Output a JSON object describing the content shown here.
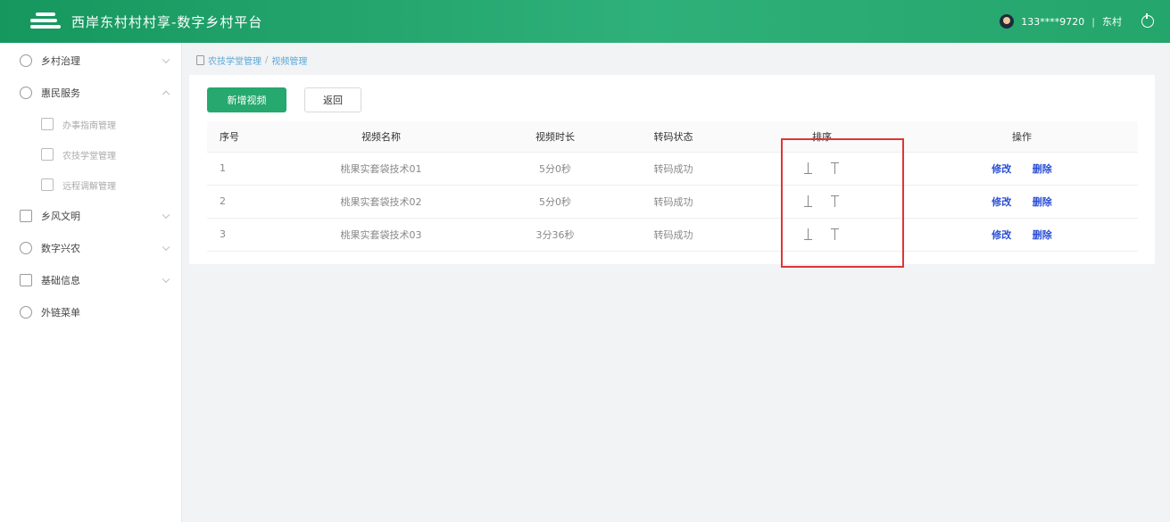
{
  "header": {
    "title": "西岸东村村村享-数字乡村平台",
    "user_phone": "133****9720",
    "separator": "|",
    "user_name": "东村"
  },
  "sidebar": {
    "items": [
      {
        "label": "乡村治理",
        "icon": "circle-icon",
        "expanded": false
      },
      {
        "label": "惠民服务",
        "icon": "circle-icon",
        "expanded": true
      },
      {
        "label": "办事指南管理",
        "icon": "doc-icon",
        "sub": true
      },
      {
        "label": "农技学堂管理",
        "icon": "book-icon",
        "sub": true
      },
      {
        "label": "远程调解管理",
        "icon": "person-icon",
        "sub": true
      },
      {
        "label": "乡风文明",
        "icon": "square-icon",
        "expanded": false
      },
      {
        "label": "数字兴农",
        "icon": "gear-icon",
        "expanded": false
      },
      {
        "label": "基础信息",
        "icon": "info-icon",
        "expanded": false
      },
      {
        "label": "外链菜单",
        "icon": "circle-icon"
      }
    ]
  },
  "breadcrumb": {
    "parent": "农技学堂管理",
    "separator": "/",
    "current": "视频管理"
  },
  "toolbar": {
    "add_label": "新增视频",
    "back_label": "返回"
  },
  "table": {
    "headers": {
      "index": "序号",
      "name": "视频名称",
      "duration": "视频时长",
      "status": "转码状态",
      "sort": "排序",
      "actions": "操作"
    },
    "rows": [
      {
        "index": "1",
        "name": "桃果实套袋技术01",
        "duration": "5分0秒",
        "status": "转码成功"
      },
      {
        "index": "2",
        "name": "桃果实套袋技术02",
        "duration": "5分0秒",
        "status": "转码成功"
      },
      {
        "index": "3",
        "name": "桃果实套袋技术03",
        "duration": "3分36秒",
        "status": "转码成功"
      }
    ],
    "edit_label": "修改",
    "delete_label": "删除"
  },
  "colors": {
    "brand": "#26a86e",
    "link": "#2b4fd6",
    "highlight": "#e03535"
  }
}
